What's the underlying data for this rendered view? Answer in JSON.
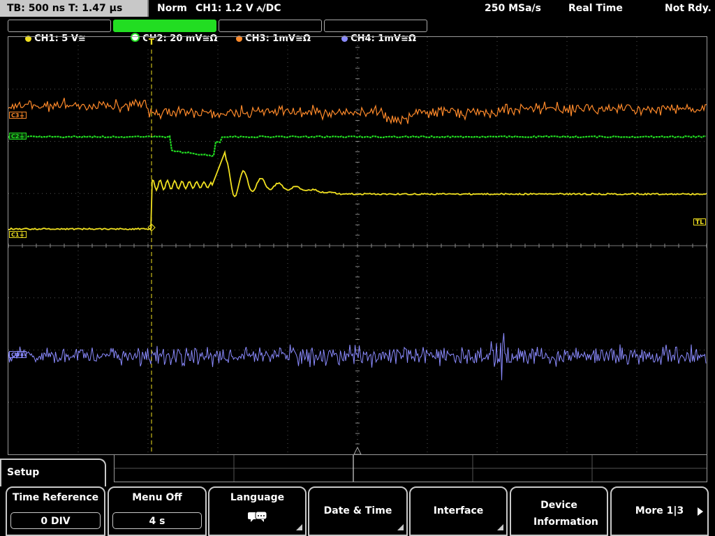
{
  "status_bar": {
    "timebase": "TB: 500 ns   T: 1.47 µs",
    "mode": "Norm",
    "trigger": "CH1: 1.2 V ⩜/DC",
    "sample_rate": "250 MSa/s",
    "acq_mode": "Real Time",
    "state": "Not Rdy."
  },
  "channels": [
    {
      "label": "CH1: 5 V≅",
      "color": "#f0e020",
      "active": false
    },
    {
      "label": "CH2: 20 mV≅Ω",
      "color": "#22dd22",
      "active": true
    },
    {
      "label": "CH3: 1mV≅Ω",
      "color": "#ff8a2a",
      "active": false
    },
    {
      "label": "CH4: 1mV≅Ω",
      "color": "#8b8bff",
      "active": false
    }
  ],
  "markers": {
    "c1": "C1⏚",
    "c2": "C2⏚",
    "c3": "C3⏚",
    "c4": "C4⏚",
    "tl": "TL",
    "trigger": "T"
  },
  "menu": {
    "title": "Setup",
    "softkeys": [
      {
        "label": "Time Reference",
        "value": "0 DIV"
      },
      {
        "label": "Menu Off",
        "value": "4 s"
      },
      {
        "label": "Language",
        "icon": "speech-bubbles-icon"
      },
      {
        "label": "Date & Time"
      },
      {
        "label": "Interface"
      },
      {
        "label": "Device Information"
      },
      {
        "label": "More 1|3"
      }
    ]
  },
  "colors": {
    "ch1": "#f0e020",
    "ch2": "#22dd22",
    "ch3": "#ff8a2a",
    "ch4": "#8b8bff",
    "grid": "#555555"
  }
}
